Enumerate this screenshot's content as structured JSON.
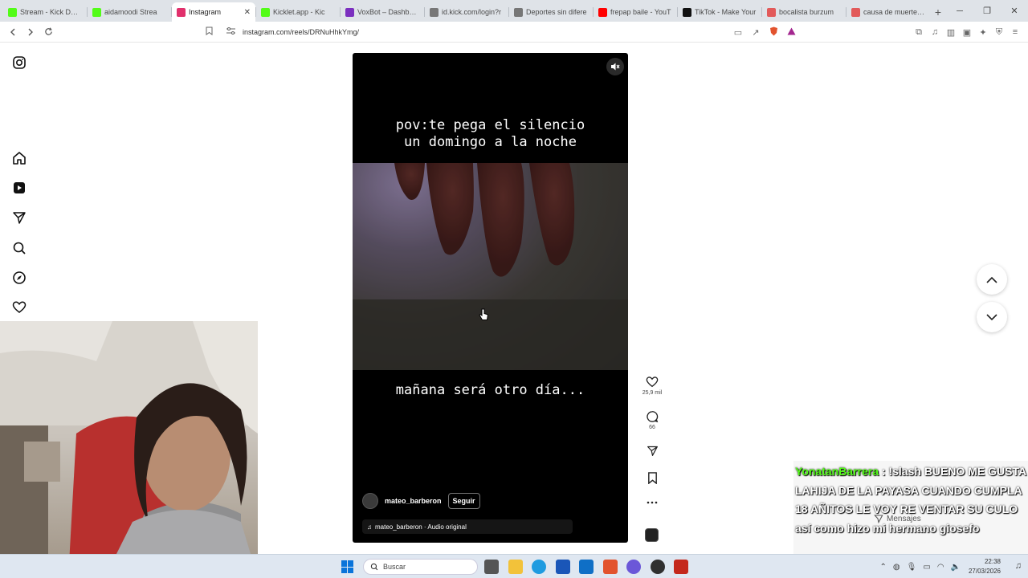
{
  "browser": {
    "tabs": [
      {
        "label": "Stream - Kick Dashb",
        "color": "#53fc18",
        "active": false
      },
      {
        "label": "aidamoodi Strea",
        "color": "#53fc18",
        "active": false
      },
      {
        "label": "Instagram",
        "color": "#e1306c",
        "active": true
      },
      {
        "label": "Kicklet.app - Kic",
        "color": "#53fc18",
        "active": false
      },
      {
        "label": "VoxBot – Dashboar",
        "color": "#7b2fbf",
        "active": false
      },
      {
        "label": "id.kick.com/login?r",
        "color": "#777777",
        "active": false
      },
      {
        "label": "Deportes sin difere",
        "color": "#777777",
        "active": false
      },
      {
        "label": "frepap baile - YouT",
        "color": "#ff0000",
        "active": false
      },
      {
        "label": "TikTok - Make Your",
        "color": "#111111",
        "active": false
      },
      {
        "label": "bocalista burzum",
        "color": "#e25a5a",
        "active": false
      },
      {
        "label": "causa de muerte de",
        "color": "#e25a5a",
        "active": false
      }
    ],
    "close_glyph": "✕",
    "new_tab_glyph": "+",
    "url": "instagram.com/reels/DRNuHhkYmg/",
    "window_controls": {
      "minimize": "─",
      "maximize": "❐",
      "close": "✕"
    }
  },
  "reel": {
    "top_caption_line1": "pov:te pega el silencio",
    "top_caption_line2": "un domingo a la noche",
    "bottom_caption": "mañana será otro día...",
    "username": "mateo_barberon",
    "follow_label": "Seguir",
    "audio_label": "mateo_barberon · Audio original"
  },
  "actions": {
    "like_count": "25,9 mil",
    "comment_count": "66"
  },
  "chat": {
    "user": "YonatanBarrera",
    "separator": " : ",
    "text": "!slash BUENO ME GUSTA LAHIJA DE LA PAYASA CUANDO CUMPLA 18 AÑITOS LE VOY RE VENTAR SU CULO así como hizo mi hermano giosefo"
  },
  "messages_label": "Mensajes",
  "taskbar": {
    "search_placeholder": "Buscar",
    "time": "22:38",
    "date": "27/03/2026"
  },
  "colors": {
    "kick_green": "#53fc18",
    "brave_orange": "#e2532e",
    "reel_bg": "#000000"
  }
}
